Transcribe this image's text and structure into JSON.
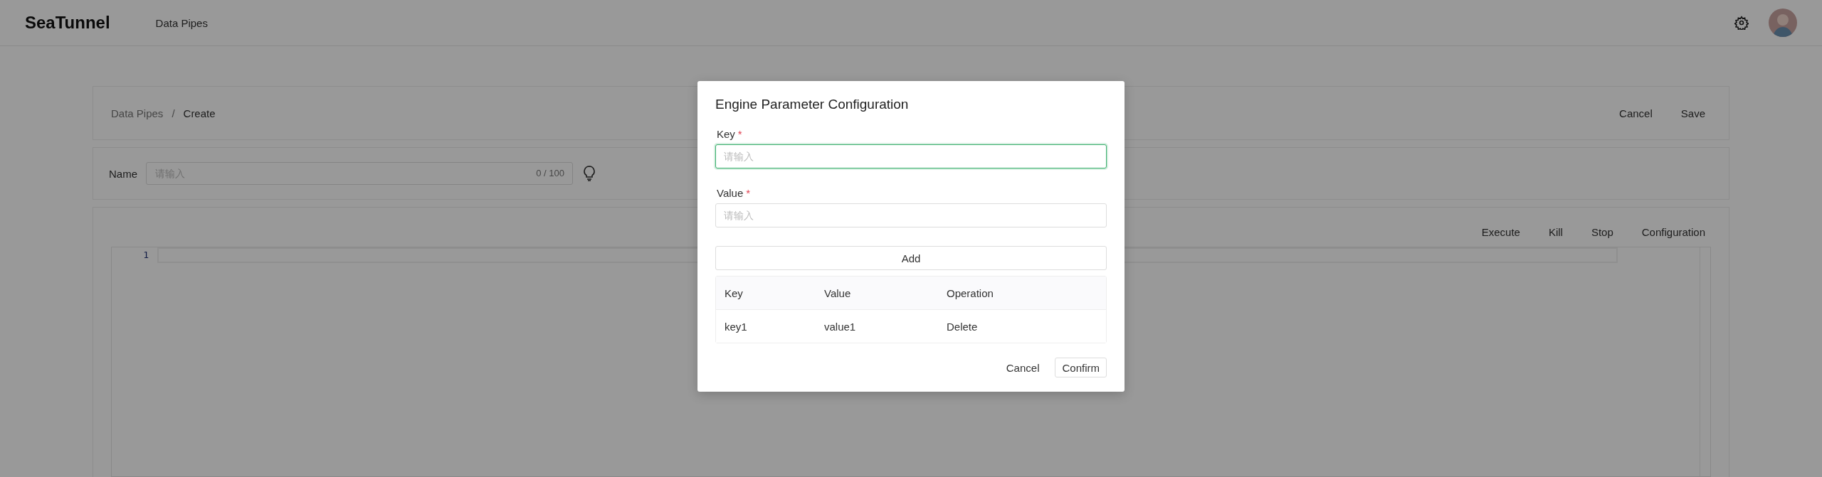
{
  "header": {
    "logo": "SeaTunnel",
    "nav": [
      "Data Pipes"
    ]
  },
  "breadcrumb": {
    "items": [
      "Data Pipes",
      "Create"
    ],
    "separator": "/"
  },
  "page_actions": [
    "Cancel",
    "Save"
  ],
  "name_field": {
    "label": "Name",
    "placeholder": "请输入",
    "counter": "0 / 100"
  },
  "editor": {
    "actions": [
      "Execute",
      "Kill",
      "Stop",
      "Configuration"
    ],
    "line_numbers": [
      "1"
    ]
  },
  "dialog": {
    "title": "Engine Parameter Configuration",
    "fields": [
      {
        "label": "Key",
        "required_mark": "*",
        "placeholder": "请输入",
        "focused": true
      },
      {
        "label": "Value",
        "required_mark": "*",
        "placeholder": "请输入",
        "focused": false
      }
    ],
    "add_button": "Add",
    "table": {
      "columns": [
        "Key",
        "Value",
        "Operation"
      ],
      "rows": [
        [
          "key1",
          "value1",
          "Delete"
        ]
      ]
    },
    "buttons": [
      {
        "label": "Cancel",
        "kind": "text"
      },
      {
        "label": "Confirm",
        "kind": "outlined"
      }
    ]
  }
}
